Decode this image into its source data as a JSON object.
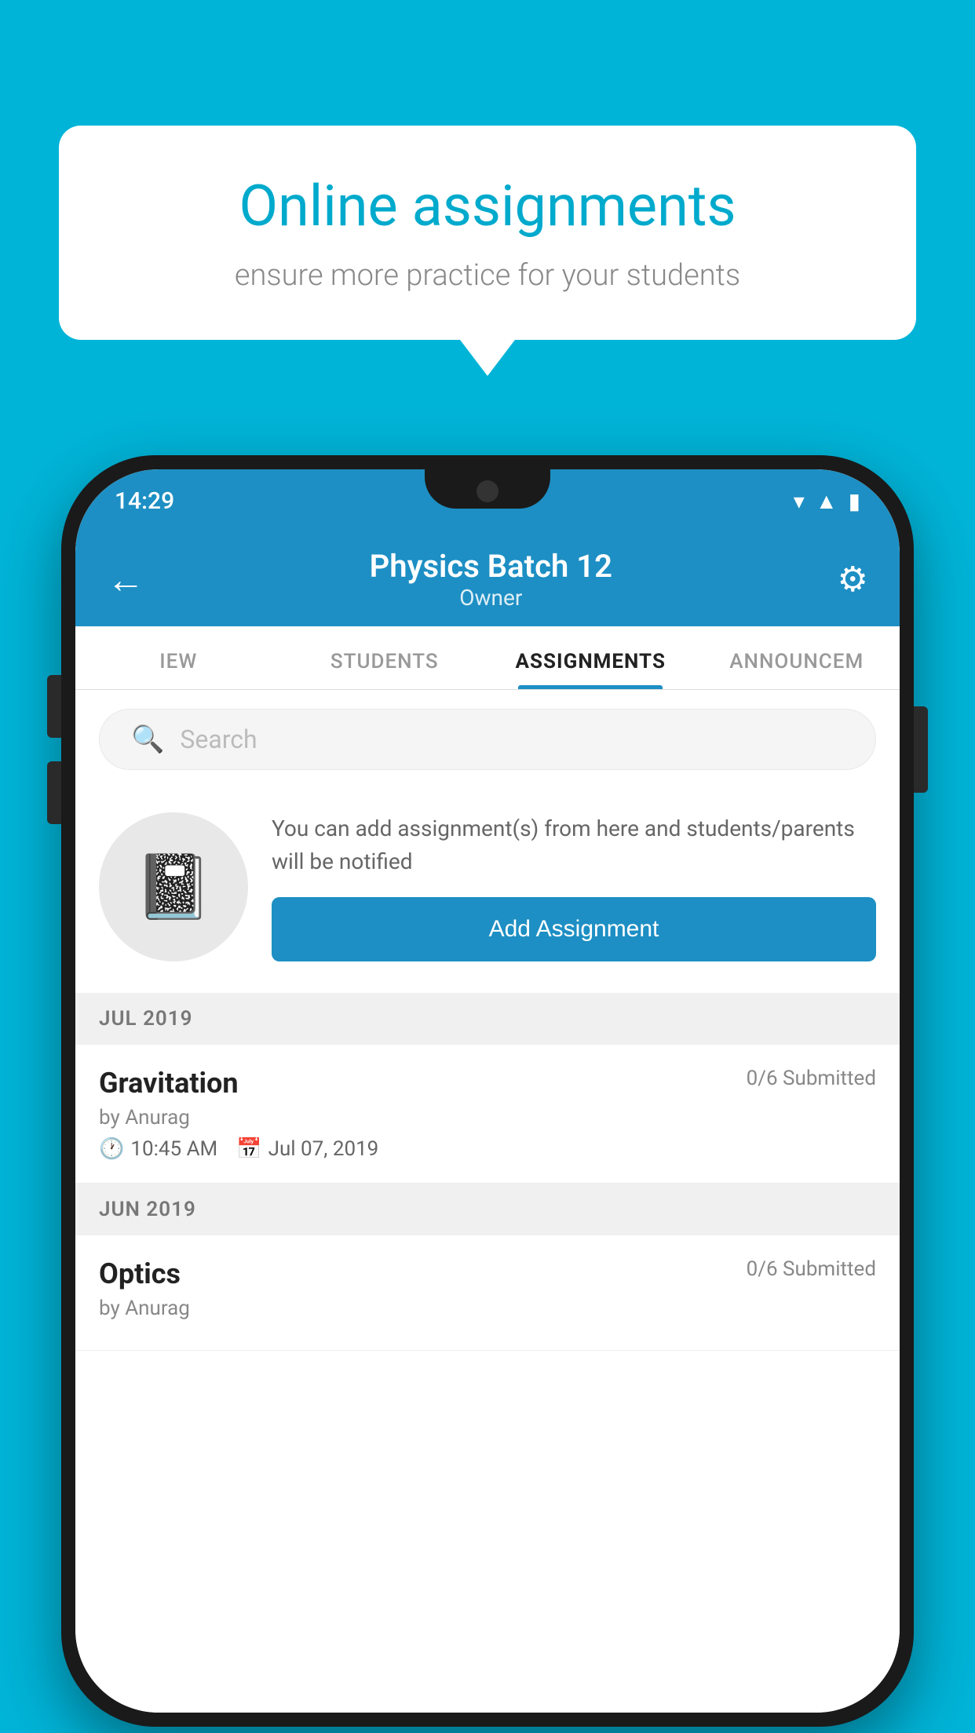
{
  "background_color": "#00b4d8",
  "speech_bubble": {
    "title": "Online assignments",
    "subtitle": "ensure more practice for your students"
  },
  "status_bar": {
    "time": "14:29",
    "wifi_icon": "wifi",
    "signal_icon": "signal",
    "battery_icon": "battery"
  },
  "header": {
    "title": "Physics Batch 12",
    "subtitle": "Owner",
    "back_icon": "←",
    "settings_icon": "⚙"
  },
  "tabs": [
    {
      "label": "IEW",
      "active": false
    },
    {
      "label": "STUDENTS",
      "active": false
    },
    {
      "label": "ASSIGNMENTS",
      "active": true
    },
    {
      "label": "ANNOUNCEM",
      "active": false
    }
  ],
  "search": {
    "placeholder": "Search",
    "icon": "🔍"
  },
  "promo_card": {
    "description": "You can add assignment(s) from here and students/parents will be notified",
    "button_label": "Add Assignment"
  },
  "sections": [
    {
      "header": "JUL 2019",
      "assignments": [
        {
          "name": "Gravitation",
          "submitted": "0/6 Submitted",
          "by": "by Anurag",
          "time": "10:45 AM",
          "date": "Jul 07, 2019"
        }
      ]
    },
    {
      "header": "JUN 2019",
      "assignments": [
        {
          "name": "Optics",
          "submitted": "0/6 Submitted",
          "by": "by Anurag",
          "time": "",
          "date": ""
        }
      ]
    }
  ]
}
